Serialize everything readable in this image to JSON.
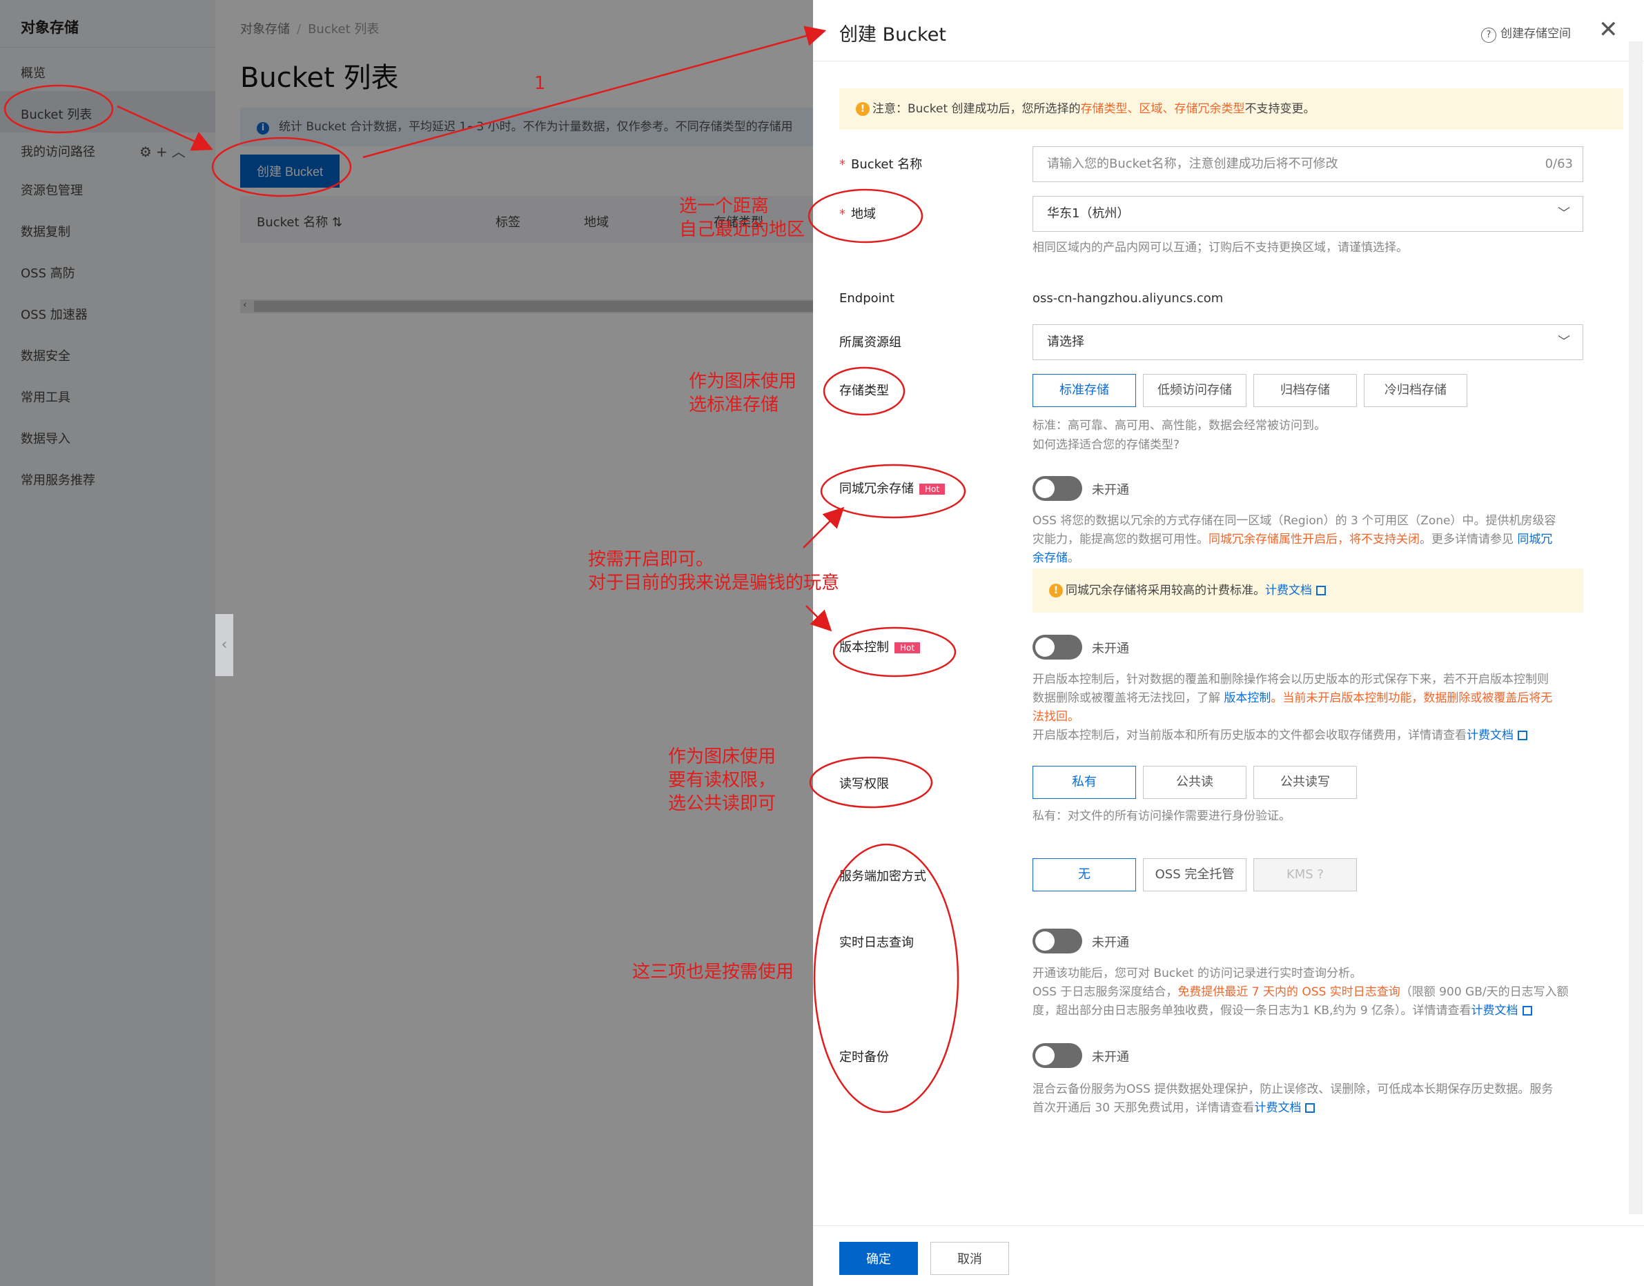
{
  "sidebar": {
    "title": "对象存储",
    "items": [
      {
        "label": "概览"
      },
      {
        "label": "Bucket 列表"
      },
      {
        "label": "我的访问路径"
      },
      {
        "label": "资源包管理"
      },
      {
        "label": "数据复制"
      },
      {
        "label": "OSS 高防"
      },
      {
        "label": "OSS 加速器"
      },
      {
        "label": "数据安全"
      },
      {
        "label": "常用工具"
      },
      {
        "label": "数据导入"
      },
      {
        "label": "常用服务推荐"
      }
    ],
    "tools": "⚙+︿"
  },
  "main": {
    "breadcrumb": [
      "对象存储",
      "Bucket 列表"
    ],
    "title": "Bucket 列表",
    "info": "统计 Bucket 合计数据，平均延迟 1~3 小时。不作为计量数据，仅作参考。不同存储类型的存储用",
    "create_button": "创建 Bucket",
    "columns": [
      "Bucket 名称 ⇅",
      "标签",
      "地域",
      "存储类型"
    ]
  },
  "drawer": {
    "title": "创建 Bucket",
    "help": "创建存储空间",
    "notice": {
      "prefix": "注意：Bucket 创建成功后，您所选择的",
      "highlight": "存储类型、区域、存储冗余类型",
      "suffix": "不支持变更。"
    },
    "bucket_name": {
      "label": "Bucket 名称",
      "placeholder": "请输入您的Bucket名称，注意创建成功后将不可修改",
      "count": "0/63"
    },
    "region": {
      "label": "地域",
      "value": "华东1（杭州）",
      "desc": "相同区域内的产品内网可以互通；订购后不支持更换区域，请谨慎选择。"
    },
    "endpoint": {
      "label": "Endpoint",
      "value": "oss-cn-hangzhou.aliyuncs.com"
    },
    "resource_group": {
      "label": "所属资源组",
      "value": "请选择"
    },
    "storage_class": {
      "label": "存储类型",
      "options": [
        "标准存储",
        "低频访问存储",
        "归档存储",
        "冷归档存储"
      ],
      "desc": "标准：高可靠、高可用、高性能，数据会经常被访问到。",
      "link": "如何选择适合您的存储类型?"
    },
    "redundancy": {
      "label": "同城冗余存储",
      "badge": "Hot",
      "state": "未开通",
      "desc1": "OSS 将您的数据以冗余的方式存储在同一区域（Region）的 3 个可用区（Zone）中。提供机房级容",
      "desc2a": "灾能力，能提高您的数据可用性。",
      "desc2b": "同城冗余存储属性开启后，将不支持关闭",
      "desc2c": "。更多详情请参见",
      "desc2d": "同城冗",
      "desc3": "余存储",
      "desc3b": "。",
      "tip": "同城冗余存储将采用较高的计费标准。",
      "tip_link": "计费文档"
    },
    "versioning": {
      "label": "版本控制",
      "badge": "Hot",
      "state": "未开通",
      "desc1": "开启版本控制后，针对数据的覆盖和删除操作将会以历史版本的形式保存下来，若不开启版本控制则",
      "desc2a": "数据删除或被覆盖将无法找回，了解",
      "desc2b": "版本控制",
      "desc2c": "。当前未开启版本控制功能，数据删除或被覆盖后将无",
      "desc3": "法找回。",
      "desc4": "开启版本控制后，对当前版本和所有历史版本的文件都会收取存储费用，详情请查看",
      "link": "计费文档"
    },
    "acl": {
      "label": "读写权限",
      "options": [
        "私有",
        "公共读",
        "公共读写"
      ],
      "desc": "私有：对文件的所有访问操作需要进行身份验证。"
    },
    "encryption": {
      "label": "服务端加密方式",
      "options": [
        "无",
        "OSS 完全托管",
        "KMS"
      ]
    },
    "realtime_log": {
      "label": "实时日志查询",
      "state": "未开通",
      "desc1": "开通该功能后，您可对 Bucket 的访问记录进行实时查询分析。",
      "desc2a": "OSS 于日志服务深度结合，",
      "desc2b": "免费提供最近 7 天内的 OSS 实时日志查询",
      "desc2c": "（限额 900 GB/天的日志写入额",
      "desc3": "度，超出部分由日志服务单独收费，假设一条日志为1 KB,约为 9 亿条）。详情请查看",
      "link": "计费文档"
    },
    "backup": {
      "label": "定时备份",
      "state": "未开通",
      "desc1": "混合云备份服务为OSS 提供数据处理保护，防止误修改、误删除，可低成本长期保存历史数据。服务",
      "desc2": "首次开通后 30 天那免费试用，详情请查看",
      "link": "计费文档"
    },
    "ok_button": "确定",
    "cancel_button": "取消"
  },
  "annotations": {
    "step": "1",
    "region_note_1": "选一个距离",
    "region_note_2": "自己最近的地区",
    "storage_note_1": "作为图床使用",
    "storage_note_2": "选标准存储",
    "redundancy_note_1": "按需开启即可。",
    "redundancy_note_2": "对于目前的我来说是骗钱的玩意",
    "acl_note_1": "作为图床使用",
    "acl_note_2": "要有读权限，",
    "acl_note_3": "选公共读即可",
    "misc_note": "这三项也是按需使用",
    "color": "#e01c1c"
  }
}
